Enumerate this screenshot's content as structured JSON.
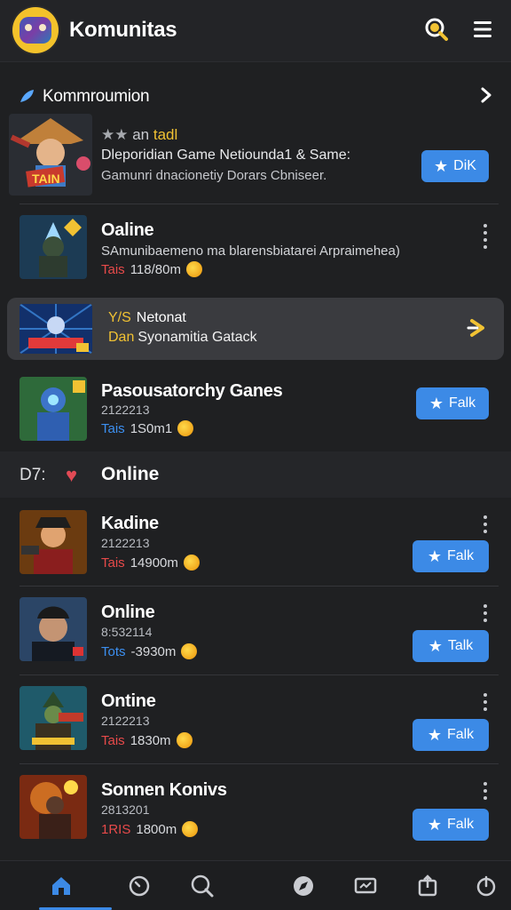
{
  "header": {
    "title": "Komunitas",
    "logo_icon": "community-logo",
    "search_icon": "search-icon",
    "menu_icon": "hamburger-menu-icon"
  },
  "section": {
    "title": "Kommroumion",
    "leaf_icon": "leaf-icon",
    "chevron_icon": "chevron-right-icon"
  },
  "featured": {
    "rating_text": "an",
    "rating_highlight": "tadl",
    "desc_line1": "Dleporidian Game Netiounda1 & Same:",
    "desc_line2": "Gamunri dnacionetiy Dorars Cbniseer.",
    "button_label": "DiK"
  },
  "item_online_1": {
    "name": "Oaline",
    "code": "SAmunibaemeno ma blarensbiatarei Arpraimehea)",
    "meta_tag": "Tais",
    "meta_value": "118/80m"
  },
  "banner": {
    "l1_prefix": "Y/S",
    "l1_text": "Netonat",
    "l2_prefix": "Dan",
    "l2_text": "Syonamitia Gatack"
  },
  "item_pasousatorchy": {
    "name": "Pasousatorchy Ganes",
    "code": "2122213",
    "meta_tag": "Tais",
    "meta_value": "1S0m1",
    "button_label": "Falk"
  },
  "category": {
    "prefix": "D7:",
    "label": "Online"
  },
  "list": [
    {
      "name": "Kadine",
      "code": "2122213",
      "meta_tag": "Tais",
      "meta_value": "14900m",
      "button_label": "Falk",
      "tag_color": "#e74a4a"
    },
    {
      "name": "Online",
      "code": "8:532114",
      "meta_tag": "Tots",
      "meta_value": "-3930m",
      "button_label": "Talk",
      "tag_color": "#3c8ff0"
    },
    {
      "name": "Ontine",
      "code": "2122213",
      "meta_tag": "Tais",
      "meta_value": "1830m",
      "button_label": "Falk",
      "tag_color": "#e74a4a"
    },
    {
      "name": "Sonnen Konivs",
      "code": "2813201",
      "meta_tag": "1RIS",
      "meta_value": "1800m",
      "button_label": "Falk",
      "tag_color": "#e74a4a"
    }
  ],
  "bottom_nav": [
    "home-icon",
    "clock-icon",
    "search-icon",
    "compass-icon",
    "display-icon",
    "share-icon",
    "power-icon"
  ],
  "colors": {
    "background": "#1f2022",
    "accent": "#3c8ae6",
    "gold": "#f1c233",
    "red": "#e74a4a"
  }
}
